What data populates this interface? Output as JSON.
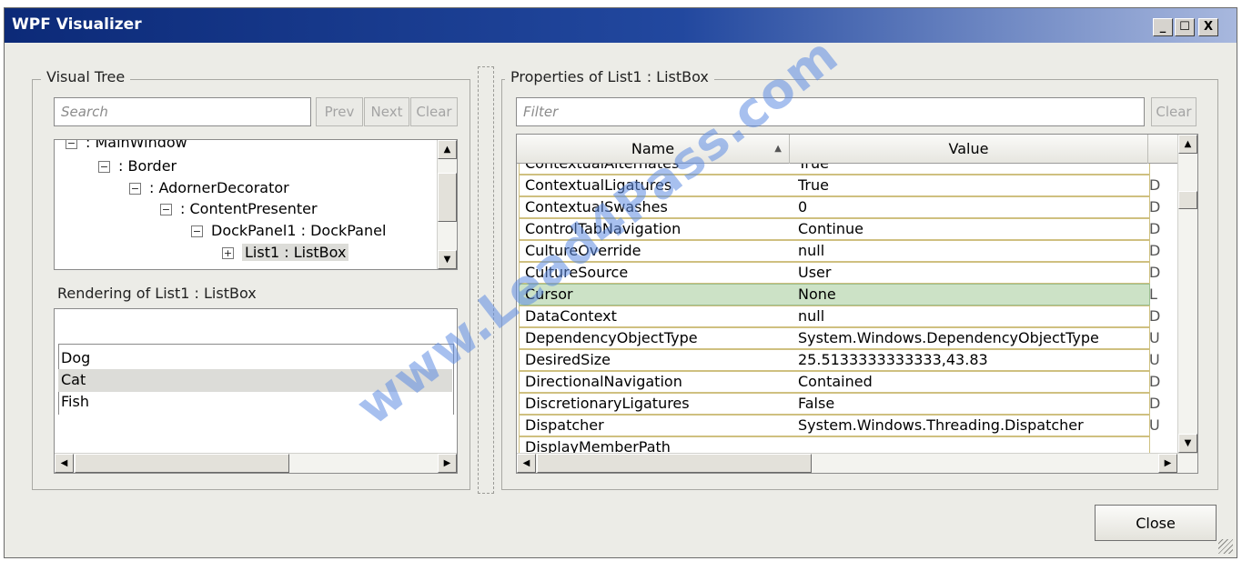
{
  "window": {
    "title": "WPF Visualizer",
    "minimize_glyph": "_",
    "maximize_glyph": "☐",
    "close_glyph": "X"
  },
  "visual_tree": {
    "group_label": "Visual Tree",
    "search_placeholder": "Search",
    "prev_label": "Prev",
    "next_label": "Next",
    "clear_label": "Clear",
    "nodes": [
      {
        "label": ": MainWindow",
        "expander": "−"
      },
      {
        "label": ": Border",
        "expander": "−"
      },
      {
        "label": ": AdornerDecorator",
        "expander": "−"
      },
      {
        "label": ": ContentPresenter",
        "expander": "−"
      },
      {
        "label": "DockPanel1 : DockPanel",
        "expander": "−"
      },
      {
        "label": "List1 : ListBox",
        "expander": "+"
      }
    ],
    "rendering_label": "Rendering of List1 : ListBox",
    "rendering_items": [
      "Dog",
      "Cat",
      "Fish"
    ]
  },
  "properties": {
    "group_label": "Properties of List1 : ListBox",
    "filter_placeholder": "Filter",
    "clear_label": "Clear",
    "columns": {
      "name": "Name",
      "value": "Value"
    },
    "rows": [
      {
        "name": "ContextualAlternates",
        "value": "True",
        "extra": ""
      },
      {
        "name": "ContextualLigatures",
        "value": "True",
        "extra": "D"
      },
      {
        "name": "ContextualSwashes",
        "value": "0",
        "extra": "D"
      },
      {
        "name": "ControlTabNavigation",
        "value": "Continue",
        "extra": "D"
      },
      {
        "name": "CultureOverride",
        "value": "null",
        "extra": "D"
      },
      {
        "name": "CultureSource",
        "value": "User",
        "extra": "D"
      },
      {
        "name": "Cursor",
        "value": "None",
        "extra": "L"
      },
      {
        "name": "DataContext",
        "value": "null",
        "extra": "D"
      },
      {
        "name": "DependencyObjectType",
        "value": "System.Windows.DependencyObjectType",
        "extra": "U"
      },
      {
        "name": "DesiredSize",
        "value": "25.5133333333333,43.83",
        "extra": "U"
      },
      {
        "name": "DirectionalNavigation",
        "value": "Contained",
        "extra": "D"
      },
      {
        "name": "DiscretionaryLigatures",
        "value": "False",
        "extra": "D"
      },
      {
        "name": "Dispatcher",
        "value": "System.Windows.Threading.Dispatcher",
        "extra": "U"
      },
      {
        "name": "DisplayMemberPath",
        "value": "",
        "extra": ""
      }
    ]
  },
  "footer": {
    "close_label": "Close"
  },
  "watermark": "www.Lead4Pass.com",
  "colors": {
    "titlebar": "#0c2a78",
    "selected_row": "#cce2c6",
    "row_border": "#cfc080"
  }
}
